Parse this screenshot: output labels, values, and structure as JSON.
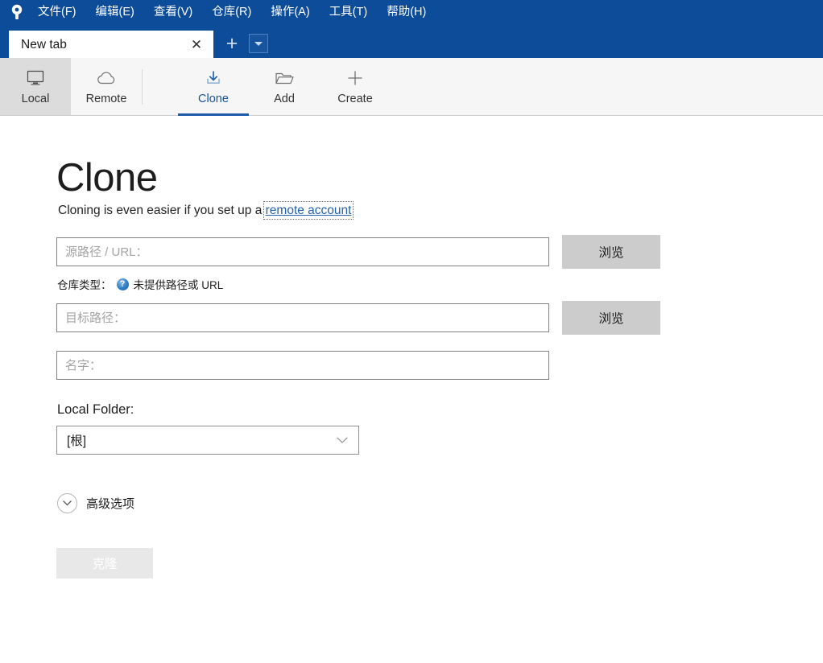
{
  "app": {
    "logo_icon": "keyhole-logo-icon",
    "accent_blue": "#0d4c99",
    "link_blue": "#2360ad",
    "tab_accent": "#1e5aa8"
  },
  "menubar": {
    "items": [
      {
        "text": "文件(F)",
        "label": "文件",
        "mnemonic": "F"
      },
      {
        "text": "编辑(E)",
        "label": "编辑",
        "mnemonic": "E"
      },
      {
        "text": "查看(V)",
        "label": "查看",
        "mnemonic": "V"
      },
      {
        "text": "仓库(R)",
        "label": "仓库",
        "mnemonic": "R"
      },
      {
        "text": "操作(A)",
        "label": "操作",
        "mnemonic": "A"
      },
      {
        "text": "工具(T)",
        "label": "工具",
        "mnemonic": "T"
      },
      {
        "text": "帮助(H)",
        "label": "帮助",
        "mnemonic": "H"
      }
    ]
  },
  "tabstrip": {
    "tabs": [
      {
        "title": "New tab",
        "close_icon": "close-icon"
      }
    ],
    "new_tab_icon": "plus-icon",
    "tab_list_icon": "chevron-down-icon"
  },
  "toolbar": {
    "buttons": [
      {
        "label": "Local",
        "icon": "monitor-icon",
        "state": "selected"
      },
      {
        "label": "Remote",
        "icon": "cloud-icon",
        "state": "normal"
      },
      {
        "label": "Clone",
        "icon": "download-icon",
        "state": "active"
      },
      {
        "label": "Add",
        "icon": "folder-icon",
        "state": "normal"
      },
      {
        "label": "Create",
        "icon": "plus-icon",
        "state": "normal"
      }
    ]
  },
  "main": {
    "title": "Clone",
    "subtitle_prefix": "Cloning is even easier if you set up a ",
    "subtitle_link": "remote account",
    "source": {
      "placeholder": "源路径 / URL：",
      "value": "",
      "browse_label": "浏览"
    },
    "repo_type": {
      "label": "仓库类型：",
      "help_icon": "help-circle-icon",
      "status": "未提供路径或 URL"
    },
    "target": {
      "placeholder": "目标路径：",
      "value": "",
      "browse_label": "浏览"
    },
    "name": {
      "placeholder": "名字：",
      "value": ""
    },
    "local_folder": {
      "label": "Local Folder:",
      "selected": "[根]",
      "chevron_icon": "chevron-down-icon"
    },
    "advanced": {
      "label": "高级选项",
      "icon": "chevron-down-circle-icon"
    },
    "submit": {
      "label": "克隆",
      "disabled": true
    }
  }
}
